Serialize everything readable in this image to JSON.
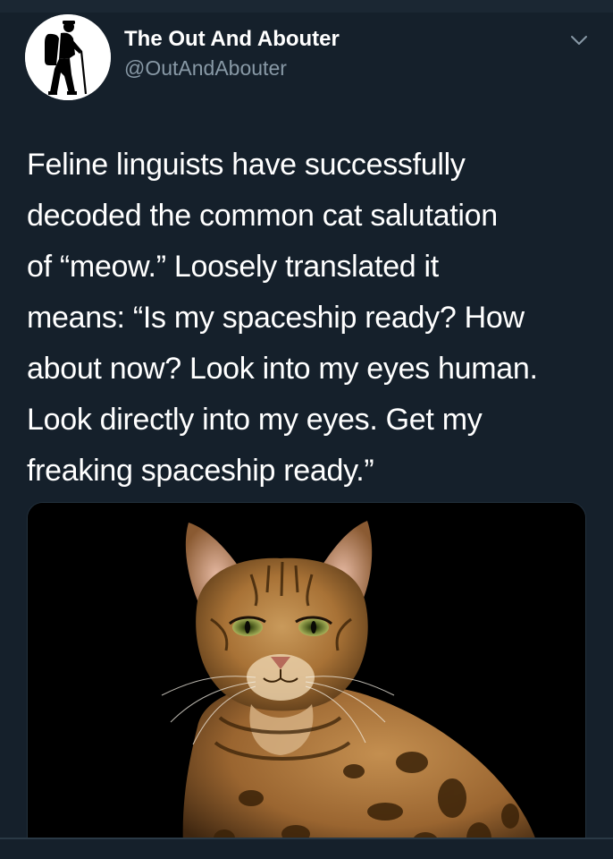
{
  "tweet": {
    "author": {
      "display_name": "The Out And Abouter",
      "handle": "@OutAndAbouter",
      "avatar_icon": "hiker-silhouette-icon"
    },
    "menu_icon": "chevron-down-icon",
    "text_lines": [
      "Feline linguists have successfully",
      "decoded the common cat salutation",
      "of “meow.” Loosely translated it",
      "means: “Is my spaceship ready? How",
      "about now? Look into my eyes human.",
      "Look directly into my eyes. Get my",
      "freaking spaceship ready.”"
    ],
    "media": {
      "subject": "bengal-cat-photo"
    }
  },
  "colors": {
    "background": "#15202b",
    "text": "#ffffff",
    "secondary_text": "#8899a6"
  }
}
